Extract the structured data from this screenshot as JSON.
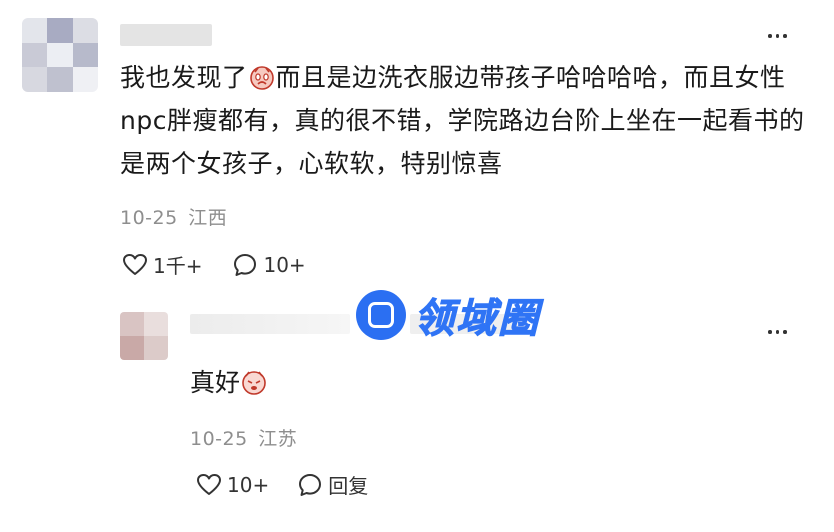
{
  "comment": {
    "text_part1": "我也发现了",
    "text_part2": "而且是边洗衣服边带孩子哈哈哈哈，而且女性npc胖瘦都有，真的很不错，学院路边台阶上坐在一起看书的是两个女孩子，心软软，特别惊喜",
    "date": "10-25",
    "location": "江西",
    "like_count": "1千+",
    "comment_count": "10+",
    "more_icon": "more-dots-icon",
    "emoji": "crying-face-emoji"
  },
  "reply": {
    "text": "真好",
    "date": "10-25",
    "location": "江苏",
    "like_count": "10+",
    "reply_label": "回复",
    "emoji": "shy-face-emoji"
  },
  "watermark": {
    "text": "领域圈",
    "color": "#2f74f5"
  }
}
